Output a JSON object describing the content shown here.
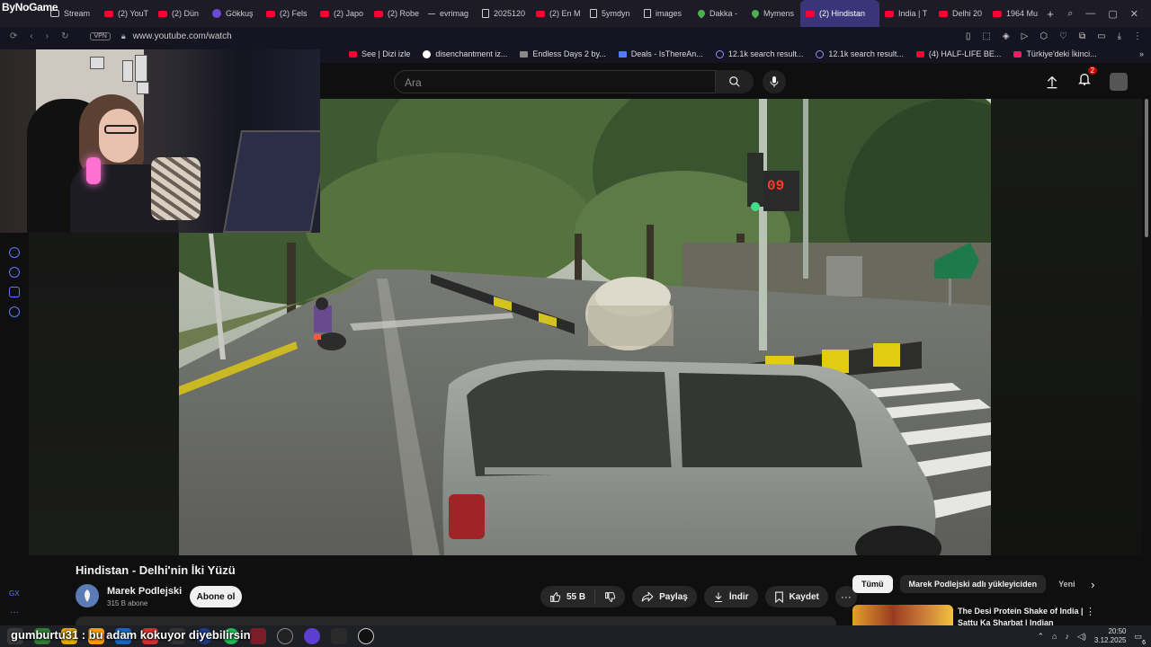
{
  "overlay": {
    "channel_logo": "ByNoGame",
    "chat_message": "gumburtu31 : bu adam kokuyor diyebilirsin"
  },
  "browser": {
    "tabs": [
      {
        "label": "Stream",
        "icon": "stream-icon"
      },
      {
        "label": "(2) YouT",
        "icon": "youtube-icon"
      },
      {
        "label": "(2) Dün",
        "icon": "youtube-icon"
      },
      {
        "label": "Gökkuş",
        "icon": "s-icon"
      },
      {
        "label": "(2) Fels",
        "icon": "youtube-icon"
      },
      {
        "label": "(2) Japo",
        "icon": "youtube-icon"
      },
      {
        "label": "(2) Robe",
        "icon": "youtube-icon"
      },
      {
        "label": "evrimag",
        "icon": "dash-icon"
      },
      {
        "label": "2025120",
        "icon": "document-icon"
      },
      {
        "label": "(2) En M",
        "icon": "youtube-icon"
      },
      {
        "label": "5ymdyn",
        "icon": "document-icon"
      },
      {
        "label": "images",
        "icon": "document-icon"
      },
      {
        "label": "Dakka -",
        "icon": "map-pin-icon"
      },
      {
        "label": "Mymens",
        "icon": "map-pin-icon"
      },
      {
        "label": "(2) Hindistan",
        "icon": "youtube-icon",
        "active": true
      },
      {
        "label": "India | T",
        "icon": "youtube-icon"
      },
      {
        "label": "Delhi 20",
        "icon": "youtube-icon"
      },
      {
        "label": "1964 Mu",
        "icon": "youtube-icon"
      }
    ],
    "url": "www.youtube.com/watch",
    "vpn_label": "VPN",
    "bookmarks": [
      {
        "label": "See | Dizi izle",
        "icon": "youtube-icon"
      },
      {
        "label": "disenchantment iz...",
        "icon": "google-icon"
      },
      {
        "label": "Endless Days 2 by...",
        "icon": "document-icon"
      },
      {
        "label": "Deals - IsThereAn...",
        "icon": "tag-icon"
      },
      {
        "label": "12.1k search result...",
        "icon": "twitch-icon"
      },
      {
        "label": "12.1k search result...",
        "icon": "twitch-icon"
      },
      {
        "label": "(4) HALF-LIFE BE...",
        "icon": "youtube-icon"
      },
      {
        "label": "Türkiye'deki İkinci...",
        "icon": "trt-icon"
      }
    ]
  },
  "youtube": {
    "search_placeholder": "Ara",
    "notification_count": "2",
    "video": {
      "title": "Hindistan - Delhi'nin İki Yüzü",
      "signal_timer": "09"
    },
    "channel": {
      "name": "Marek Podlejski",
      "subscribers": "315 B abone",
      "subscribe_label": "Abone ol"
    },
    "actions": {
      "like_count": "55 B",
      "share_label": "Paylaş",
      "download_label": "İndir",
      "save_label": "Kaydet"
    },
    "chips": [
      "Tümü",
      "Marek Podlejski adlı yükleyiciden",
      "Yeni"
    ],
    "recommendation": {
      "title": "The Desi Protein Shake of India | Sattu Ka Sharbat | Indian"
    }
  },
  "taskbar": {
    "time": "20:50",
    "date": "3.12.2025",
    "notification_count": "6"
  },
  "colors": {
    "accent": "#ff0033",
    "active_tab": "#3a3578",
    "background": "#0f0f0f"
  }
}
